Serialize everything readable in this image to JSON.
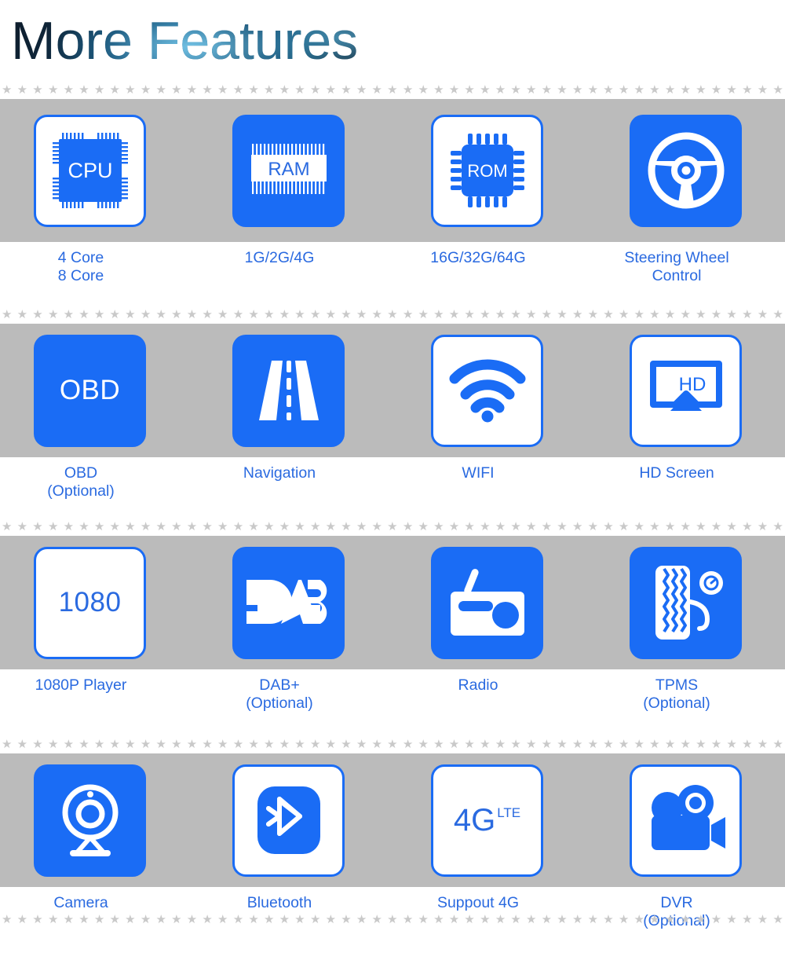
{
  "header": {
    "title": "More Features"
  },
  "divider": {
    "glyph": "★",
    "color": "#c9c9c9",
    "count": 62
  },
  "theme": {
    "brand_blue": "#1a6cf5",
    "label_blue": "#2a6ae0",
    "band_gray": "#bbbbbb",
    "white": "#ffffff"
  },
  "rows": [
    {
      "items": [
        {
          "icon": "cpu-chip-icon",
          "tile_style": "outline",
          "tile_text": "CPU",
          "label": "4 Core\n8 Core"
        },
        {
          "icon": "ram-module-icon",
          "tile_style": "solid",
          "tile_text": "RAM",
          "label": "1G/2G/4G"
        },
        {
          "icon": "rom-chip-icon",
          "tile_style": "outline",
          "tile_text": "ROM",
          "label": "16G/32G/64G"
        },
        {
          "icon": "steering-wheel-icon",
          "tile_style": "solid",
          "tile_text": "",
          "label": "Steering Wheel\nControl"
        }
      ]
    },
    {
      "items": [
        {
          "icon": "obd-text-icon",
          "tile_style": "solid",
          "tile_text": "OBD",
          "label": "OBD\n(Optional)"
        },
        {
          "icon": "road-icon",
          "tile_style": "solid",
          "tile_text": "",
          "label": "Navigation"
        },
        {
          "icon": "wifi-icon",
          "tile_style": "outline",
          "tile_text": "",
          "label": "WIFI"
        },
        {
          "icon": "hd-screen-icon",
          "tile_style": "outline",
          "tile_text": "HD",
          "label": "HD Screen"
        }
      ]
    },
    {
      "items": [
        {
          "icon": "resolution-1080-icon",
          "tile_style": "outline",
          "tile_text": "1080",
          "label": "1080P Player"
        },
        {
          "icon": "dab-logo-icon",
          "tile_style": "solid",
          "tile_text": "DAB",
          "label": "DAB+\n(Optional)"
        },
        {
          "icon": "radio-icon",
          "tile_style": "solid",
          "tile_text": "",
          "label": "Radio"
        },
        {
          "icon": "tire-pressure-icon",
          "tile_style": "solid",
          "tile_text": "",
          "label": "TPMS\n(Optional)"
        }
      ]
    },
    {
      "items": [
        {
          "icon": "webcam-icon",
          "tile_style": "solid",
          "tile_text": "",
          "label": "Camera"
        },
        {
          "icon": "bluetooth-icon",
          "tile_style": "outline",
          "tile_text": "",
          "label": "Bluetooth"
        },
        {
          "icon": "4g-lte-icon",
          "tile_style": "outline",
          "tile_text": "4G",
          "tile_text_sup": "LTE",
          "label": "Suppout 4G"
        },
        {
          "icon": "dvr-camcorder-icon",
          "tile_style": "solid",
          "tile_text": "",
          "label": "DVR\n(Optional)"
        }
      ]
    }
  ]
}
